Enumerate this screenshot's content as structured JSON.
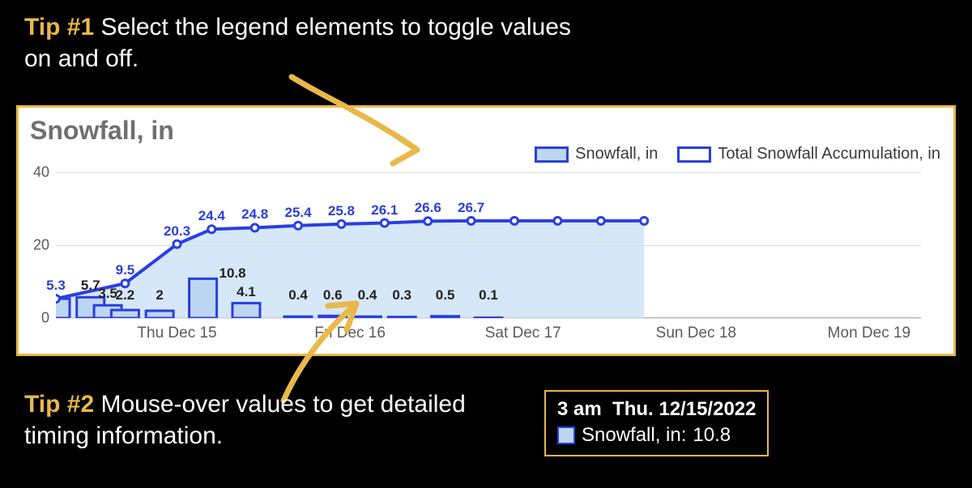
{
  "tips": {
    "tip1": {
      "label": "Tip #1",
      "text": "Select the legend elements to toggle values on and off."
    },
    "tip2": {
      "label": "Tip #2",
      "text": "Mouse-over values to get detailed timing information."
    }
  },
  "tooltip": {
    "time": "3 am",
    "date": "Thu. 12/15/2022",
    "series": "Snowfall, in:",
    "value": "10.8"
  },
  "chart_data": {
    "type": "bar+line",
    "title": "Snowfall, in",
    "ylabel": "",
    "xlabel": "",
    "ylim": [
      0,
      40
    ],
    "y_ticks": [
      0,
      20,
      40
    ],
    "x_tick_labels": [
      "Thu Dec 15",
      "Fri Dec 16",
      "Sat Dec 17",
      "Sun Dec 18",
      "Mon Dec 19"
    ],
    "legend": [
      {
        "name": "Snowfall, in",
        "style": "filled"
      },
      {
        "name": "Total Snowfall Accumulation, in",
        "style": "hollow"
      }
    ],
    "series": [
      {
        "name": "Snowfall, in",
        "type": "bar",
        "points": [
          {
            "x_frac": 0.0,
            "value": 5.3
          },
          {
            "x_frac": 0.04,
            "value": 5.7
          },
          {
            "x_frac": 0.06,
            "value": 3.5
          },
          {
            "x_frac": 0.08,
            "value": 2.2
          },
          {
            "x_frac": 0.12,
            "value": 2.0
          },
          {
            "x_frac": 0.17,
            "value": 10.8
          },
          {
            "x_frac": 0.22,
            "value": 4.1
          },
          {
            "x_frac": 0.28,
            "value": 0.4
          },
          {
            "x_frac": 0.32,
            "value": 0.6
          },
          {
            "x_frac": 0.36,
            "value": 0.4
          },
          {
            "x_frac": 0.4,
            "value": 0.3
          },
          {
            "x_frac": 0.45,
            "value": 0.5
          },
          {
            "x_frac": 0.5,
            "value": 0.1
          }
        ]
      },
      {
        "name": "Total Snowfall Accumulation, in",
        "type": "line",
        "points": [
          {
            "x_frac": 0.0,
            "value": 5.3
          },
          {
            "x_frac": 0.08,
            "value": 9.5
          },
          {
            "x_frac": 0.14,
            "value": 20.3
          },
          {
            "x_frac": 0.18,
            "value": 24.4
          },
          {
            "x_frac": 0.23,
            "value": 24.8
          },
          {
            "x_frac": 0.28,
            "value": 25.4
          },
          {
            "x_frac": 0.33,
            "value": 25.8
          },
          {
            "x_frac": 0.38,
            "value": 26.1
          },
          {
            "x_frac": 0.43,
            "value": 26.6
          },
          {
            "x_frac": 0.48,
            "value": 26.7
          },
          {
            "x_frac": 0.53,
            "value": 26.7
          },
          {
            "x_frac": 0.58,
            "value": 26.7
          },
          {
            "x_frac": 0.63,
            "value": 26.7
          },
          {
            "x_frac": 0.68,
            "value": 26.7
          }
        ],
        "labeled_until_index": 9
      }
    ],
    "highlight_label_near_bar": {
      "x_frac": 0.17,
      "text": "10.8"
    }
  }
}
